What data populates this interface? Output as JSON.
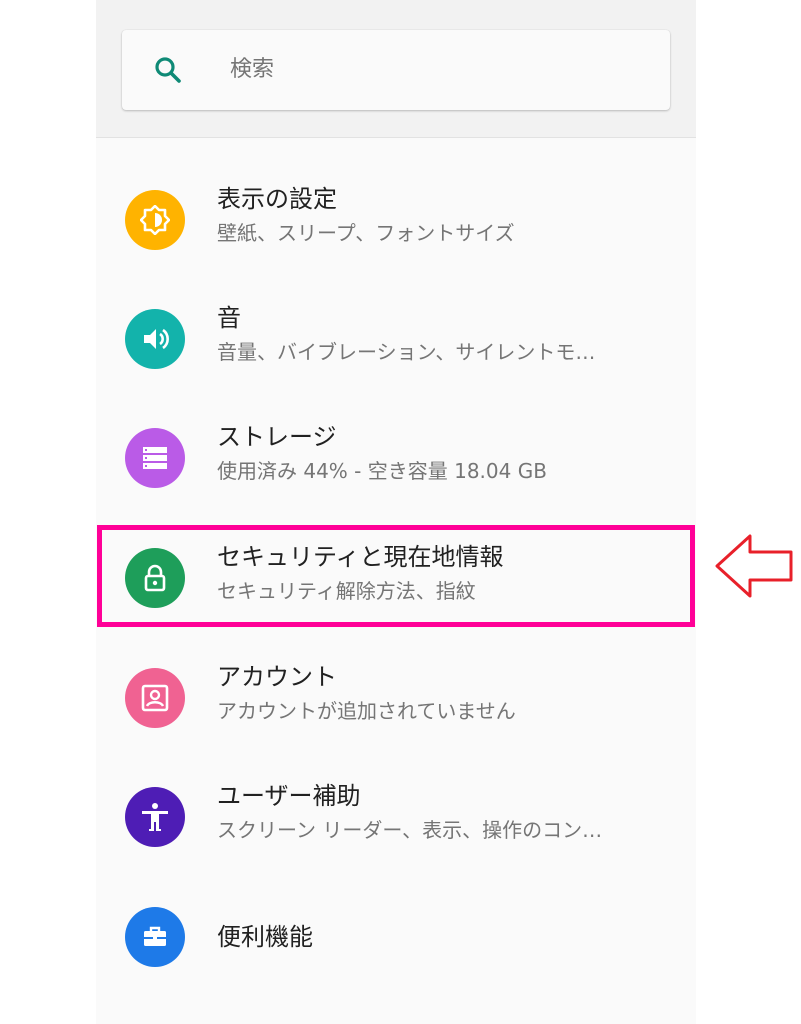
{
  "search": {
    "placeholder": "検索"
  },
  "items": [
    {
      "title": "表示の設定",
      "summary": "壁紙、スリープ、フォントサイズ",
      "icon": "brightness-icon",
      "color": "#FFB300"
    },
    {
      "title": "音",
      "summary": "音量、バイブレーション、サイレントモ…",
      "icon": "volume-icon",
      "color": "#13B3AB"
    },
    {
      "title": "ストレージ",
      "summary": "使用済み 44% - 空き容量 18.04 GB",
      "icon": "storage-icon",
      "color": "#BA5BE7"
    },
    {
      "title": "セキュリティと現在地情報",
      "summary": "セキュリティ解除方法、指紋",
      "icon": "lock-icon",
      "color": "#1E9E5A"
    },
    {
      "title": "アカウント",
      "summary": "アカウントが追加されていません",
      "icon": "account-icon",
      "color": "#F06292"
    },
    {
      "title": "ユーザー補助",
      "summary": "スクリーン リーダー、表示、操作のコン…",
      "icon": "accessibility-icon",
      "color": "#4E1DB5"
    },
    {
      "title": "便利機能",
      "summary": "",
      "icon": "toolbox-icon",
      "color": "#1E7AE8"
    }
  ],
  "annotation": {
    "highlight_color": "#FF0097",
    "arrow_color": "#E8202A",
    "highlighted_item": "セキュリティと現在地情報"
  }
}
